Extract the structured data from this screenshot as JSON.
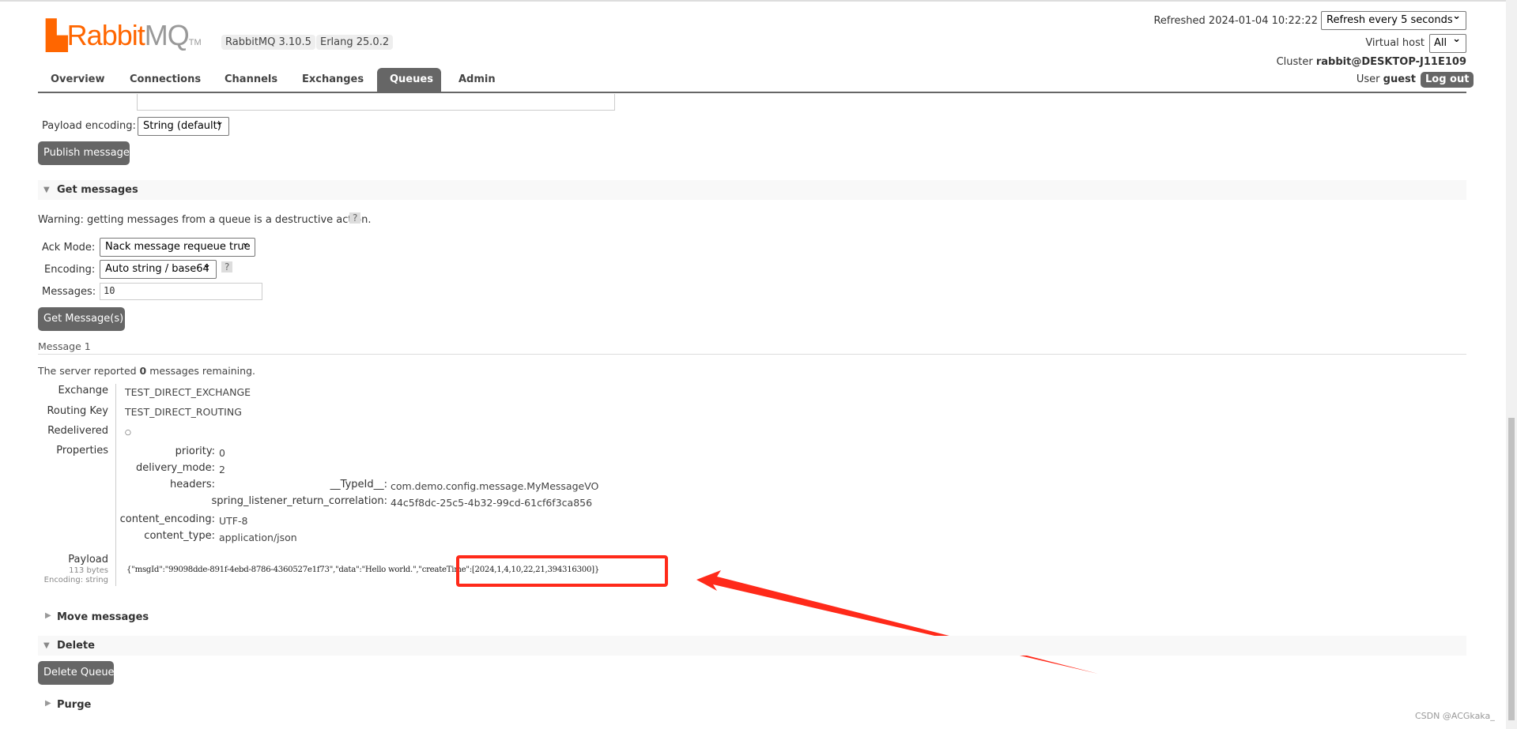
{
  "app": {
    "logo": "RabbitMQ",
    "version": "RabbitMQ 3.10.5",
    "erlang": "Erlang 25.0.2"
  },
  "header": {
    "refreshed": "Refreshed 2024-01-04 10:22:22",
    "refresh_select": "Refresh every 5 seconds",
    "vhost_label": "Virtual host",
    "vhost_select": "All",
    "cluster_label": "Cluster",
    "cluster": "rabbit@DESKTOP-J11E109",
    "user_label": "User",
    "user": "guest",
    "logout": "Log out"
  },
  "tabs": [
    {
      "label": "Overview"
    },
    {
      "label": "Connections"
    },
    {
      "label": "Channels"
    },
    {
      "label": "Exchanges"
    },
    {
      "label": "Queues",
      "active": true
    },
    {
      "label": "Admin"
    }
  ],
  "publish": {
    "payload_encoding_label": "Payload encoding:",
    "payload_encoding": "String (default)",
    "button": "Publish message"
  },
  "get": {
    "title": "Get messages",
    "warning": "Warning: getting messages from a queue is a destructive action.",
    "help": "?",
    "ack_label": "Ack Mode:",
    "ack": "Nack message requeue true",
    "enc_label": "Encoding:",
    "enc": "Auto string / base64",
    "messages_label": "Messages:",
    "messages": "10",
    "button": "Get Message(s)"
  },
  "message": {
    "title": "Message 1",
    "remaining_pre": "The server reported ",
    "remaining": "0",
    "remaining_post": " messages remaining.",
    "exchange_label": "Exchange",
    "exchange": "TEST_DIRECT_EXCHANGE",
    "routing_label": "Routing Key",
    "routing": "TEST_DIRECT_ROUTING",
    "redelivered_label": "Redelivered",
    "redelivered": "○",
    "properties_label": "Properties",
    "props": {
      "priority_k": "priority:",
      "priority": "0",
      "delivery_k": "delivery_mode:",
      "delivery": "2",
      "headers_k": "headers:",
      "typeid_k": "__TypeId__:",
      "typeid": "com.demo.config.message.MyMessageVO",
      "corr_k": "spring_listener_return_correlation:",
      "corr": "44c5f8dc-25c5-4b32-99cd-61cf6f3ca856",
      "cenc_k": "content_encoding:",
      "cenc": "UTF-8",
      "ctype_k": "content_type:",
      "ctype": "application/json"
    },
    "payload_label": "Payload",
    "payload_size": "113 bytes",
    "payload_encoding": "Encoding: string",
    "payload": "{\"msgId\":\"99098dde-891f-4ebd-8786-4360527e1f73\",\"data\":\"Hello world.\",\"createTime\":[2024,1,4,10,22,21,394316300]}"
  },
  "sections": {
    "move": "Move messages",
    "delete": "Delete",
    "delete_button": "Delete Queue",
    "purge": "Purge"
  },
  "watermark": "CSDN @ACGkaka_",
  "colors": {
    "accent": "#ff6600",
    "annotation": "#ff2a1a",
    "button": "#666666"
  }
}
